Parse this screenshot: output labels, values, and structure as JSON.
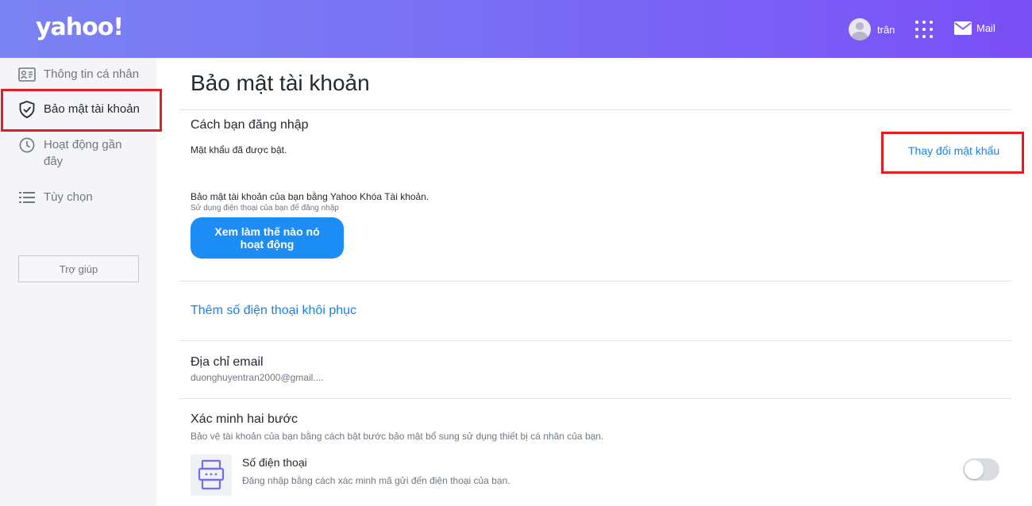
{
  "colors": {
    "accent": "#1a82e2",
    "button": "#1c8df5",
    "highlight": "#e41c24",
    "header_start": "#7b83f3",
    "header_end": "#7a4ff6"
  },
  "header": {
    "logo": "yahoo!",
    "user_name": "trân",
    "apps_icon": "grid-icon",
    "mail_label": "Mail"
  },
  "sidebar": {
    "items": [
      {
        "label": "Thông tin cá nhân",
        "icon": "id-card-icon"
      },
      {
        "label": "Bảo mật tài khoản",
        "icon": "shield-icon",
        "active": true
      },
      {
        "label": "Hoạt động gần đây",
        "icon": "clock-icon"
      },
      {
        "label": "Tùy chọn",
        "icon": "list-icon"
      }
    ],
    "help_label": "Trợ giúp"
  },
  "main": {
    "title": "Bảo mật tài khoản",
    "signin": {
      "title": "Cách bạn đăng nhập",
      "password_status": "Mật khẩu đã được bật.",
      "change_password_link": "Thay đổi mật khẩu",
      "account_key_text": "Bảo mật tài khoản của bạn bằng Yahoo Khóa Tài khoản.",
      "account_key_sub": "Sử dụng điện thoại của bạn để đăng nhập",
      "how_button": "Xem làm thế nào nó hoạt động"
    },
    "recovery_phone_link": "Thêm số điện thoại khôi phục",
    "email": {
      "title": "Địa chỉ email",
      "value": "duonghuyentran2000@gmail...."
    },
    "two_step": {
      "title": "Xác minh hai bước",
      "description": "Bảo vệ tài khoản của bạn bằng cách bật bước bảo mật bổ sung sử dụng thiết bị cá nhân của bạn.",
      "phone_option": {
        "title": "Số điện thoại",
        "description": "Đăng nhập bằng cách xác minh mã gửi đến điện thoại của bạn.",
        "enabled": false
      }
    }
  }
}
